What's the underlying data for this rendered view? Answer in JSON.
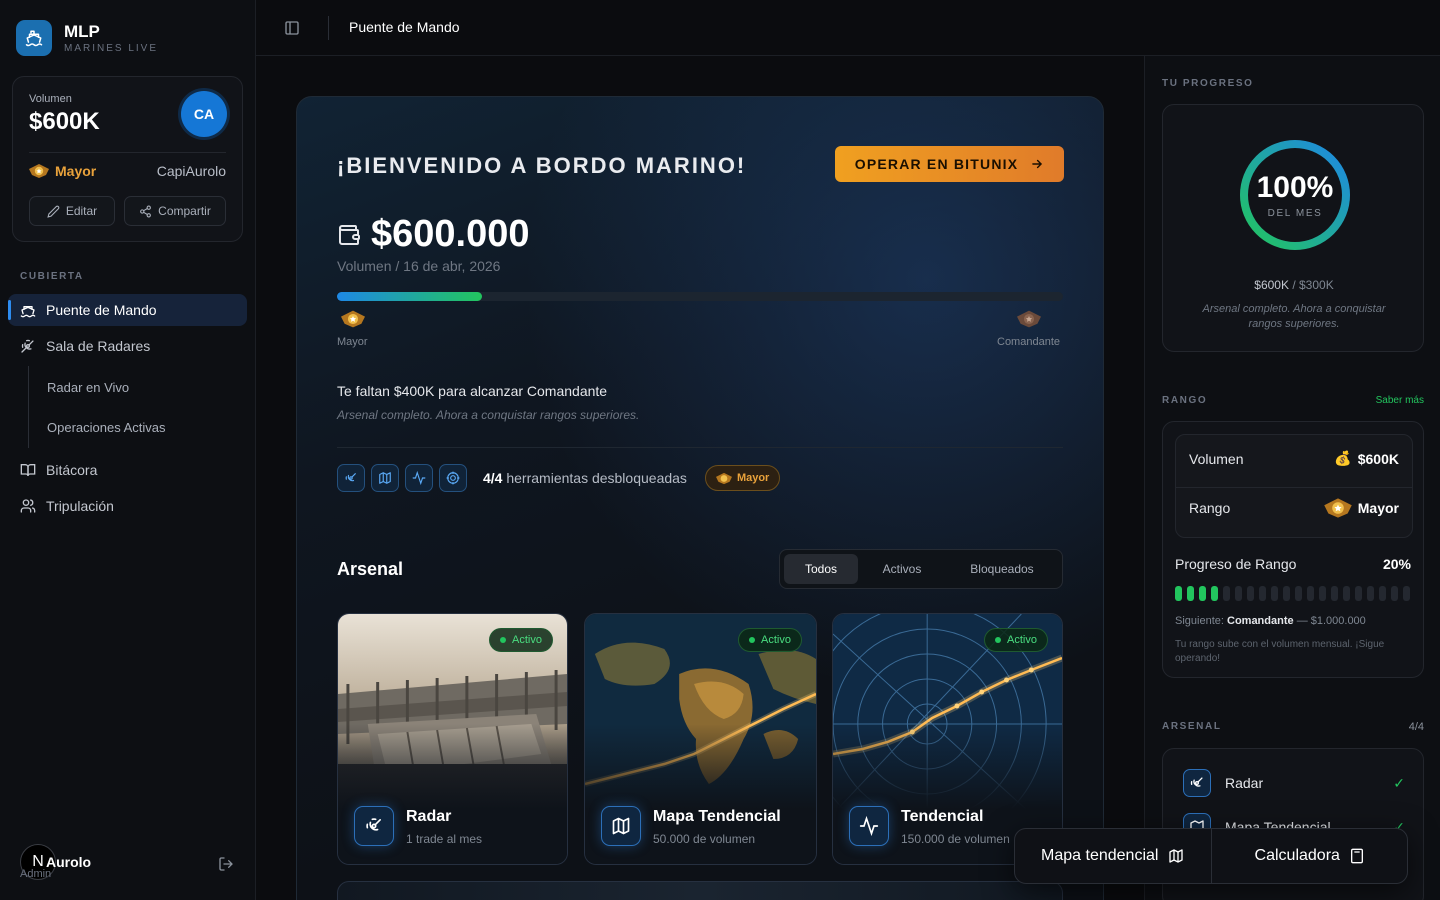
{
  "brand": {
    "name": "MLP",
    "subtitle": "MARINES LIVE",
    "logo_icon": "ship-icon"
  },
  "volume_card": {
    "label": "Volumen",
    "value": "$600K",
    "avatar_initials": "CA",
    "rank": "Mayor",
    "user": "CapiAurolo",
    "edit_label": "Editar",
    "share_label": "Compartir"
  },
  "nav": {
    "section": "CUBIERTA",
    "items": {
      "bridge": "Puente de Mando",
      "radars": "Sala de Radares",
      "live_radar": "Radar en Vivo",
      "active_ops": "Operaciones Activas",
      "log": "Bitácora",
      "crew": "Tripulación"
    }
  },
  "footer": {
    "avatar": "N",
    "name": "Aurolo",
    "sub": "Admin"
  },
  "topbar": {
    "title": "Puente de Mando"
  },
  "hero": {
    "welcome": "¡BIENVENIDO A BORDO MARINO!",
    "cta": "OPERAR EN BITUNIX",
    "amount": "$600.000",
    "amount_sub": "Volumen / 16 de abr, 2026",
    "progress": 0.2,
    "rank_current": "Mayor",
    "rank_next": "Comandante",
    "need": "Te faltan $400K para alcanzar Comandante",
    "need_sub": "Arsenal completo. Ahora a conquistar rangos superiores.",
    "tools_count": "4/4",
    "tools_text": "herramientas desbloqueadas",
    "tools_badge": "Mayor"
  },
  "arsenal": {
    "title": "Arsenal",
    "tabs": {
      "all": "Todos",
      "active": "Activos",
      "locked": "Bloqueados"
    },
    "active_label": "Activo",
    "cards": [
      {
        "title": "Radar",
        "sub": "1 trade al mes",
        "icon": "radar-icon"
      },
      {
        "title": "Mapa Tendencial",
        "sub": "50.000 de volumen",
        "icon": "map-icon"
      },
      {
        "title": "Tendencial",
        "sub": "150.000 de volumen",
        "icon": "activity-icon"
      }
    ]
  },
  "right": {
    "progress_label": "TU PROGRESO",
    "ring_value": "100%",
    "ring_fraction": 1.0,
    "ring_sub": "DEL MES",
    "amount_now": "$600K",
    "amount_sep": " / ",
    "amount_goal": "$300K",
    "progress_note": "Arsenal completo. Ahora a conquistar rangos superiores.",
    "rank_label": "RANGO",
    "learn_more": "Saber más",
    "vol_label": "Volumen",
    "vol_value": "$600K",
    "rank_row_label": "Rango",
    "rank_value": "Mayor",
    "rank_progress_title": "Progreso de Rango",
    "rank_progress_pct": "20%",
    "segments_on": 4,
    "segments_total": 20,
    "next_prefix": "Siguiente:",
    "next_rank": "Comandante",
    "next_amount": "— $1.000.000",
    "next_note": "Tu rango sube con el volumen mensual. ¡Sigue operando!",
    "arsenal_label": "ARSENAL",
    "arsenal_count": "4/4",
    "arsenal_items": [
      "Radar",
      "Mapa Tendencial"
    ]
  },
  "floatbar": {
    "map": "Mapa tendencial",
    "calc": "Calculadora"
  },
  "colors": {
    "accent": "#2d8cf0",
    "success": "#22c55e",
    "cta": "#f0a020",
    "rank_gold": "#e9a23b"
  }
}
